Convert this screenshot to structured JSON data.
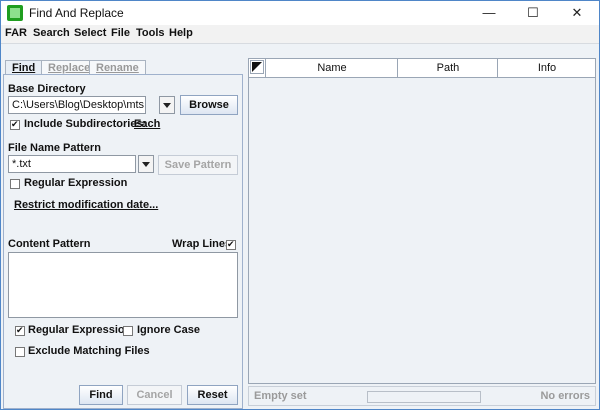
{
  "window": {
    "title": "Find And Replace",
    "controls": {
      "minimize": "—",
      "maximize": "☐",
      "close": "✕"
    }
  },
  "menu": {
    "items": [
      "FAR",
      "Search",
      "Select",
      "File",
      "Tools",
      "Help"
    ]
  },
  "tabs": [
    {
      "label": "Find",
      "active": true
    },
    {
      "label": "Replace",
      "active": false
    },
    {
      "label": "Rename",
      "active": false
    }
  ],
  "find": {
    "base_directory_label": "Base Directory",
    "base_directory_value": "C:\\Users\\Blog\\Desktop\\mts sche...",
    "browse_label": "Browse",
    "include_subdirectories_label": "Include Subdirectories:",
    "include_subdirectories_checked": true,
    "each_link": "Each",
    "file_name_pattern_label": "File Name Pattern",
    "file_name_pattern_value": "*.txt",
    "save_pattern_label": "Save Pattern",
    "regex_label": "Regular Expression",
    "regex_checked": false,
    "restrict_date_link": "Restrict modification date...",
    "content_pattern_label": "Content Pattern",
    "wrap_lines_label": "Wrap Lines",
    "wrap_lines_checked": true,
    "content_regex_label": "Regular Expression",
    "content_regex_checked": true,
    "ignore_case_label": "Ignore Case",
    "ignore_case_checked": false,
    "exclude_matching_label": "Exclude Matching Files",
    "exclude_matching_checked": false,
    "buttons": {
      "find": "Find",
      "cancel": "Cancel",
      "reset": "Reset"
    }
  },
  "results": {
    "columns": [
      "Name",
      "Path",
      "Info"
    ],
    "status_left": "Empty set",
    "status_right": "No errors"
  }
}
